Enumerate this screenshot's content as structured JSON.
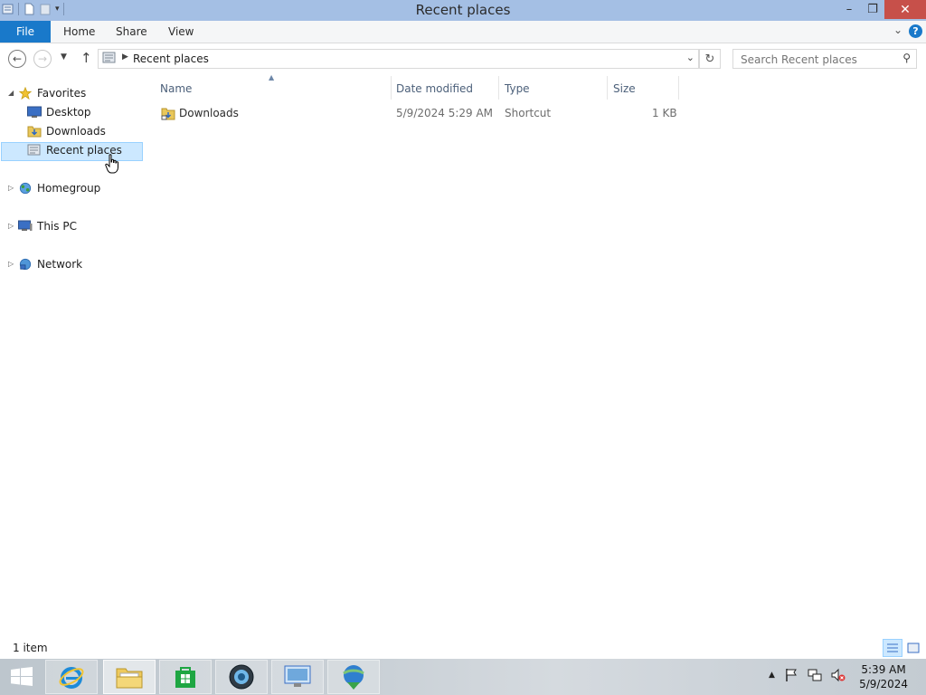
{
  "window": {
    "title": "Recent places",
    "controls": {
      "minimize": "–",
      "restore": "❐",
      "close": "✕"
    }
  },
  "ribbon": {
    "tabs": [
      {
        "label": "File"
      },
      {
        "label": "Home"
      },
      {
        "label": "Share"
      },
      {
        "label": "View"
      }
    ],
    "help": "?"
  },
  "address_bar": {
    "location": "Recent places",
    "search_placeholder": "Search Recent places"
  },
  "nav_pane": {
    "favorites": {
      "label": "Favorites",
      "items": [
        {
          "label": "Desktop",
          "icon": "desktop-icon"
        },
        {
          "label": "Downloads",
          "icon": "downloads-folder-icon"
        },
        {
          "label": "Recent places",
          "icon": "recent-places-icon",
          "selected": true
        }
      ]
    },
    "groups": [
      {
        "label": "Homegroup",
        "icon": "homegroup-icon"
      },
      {
        "label": "This PC",
        "icon": "this-pc-icon"
      },
      {
        "label": "Network",
        "icon": "network-icon"
      }
    ]
  },
  "file_list": {
    "columns": [
      "Name",
      "Date modified",
      "Type",
      "Size"
    ],
    "rows": [
      {
        "name": "Downloads",
        "date_modified": "5/9/2024 5:29 AM",
        "type": "Shortcut",
        "size": "1 KB"
      }
    ]
  },
  "status_bar": {
    "item_count": "1 item"
  },
  "taskbar": {
    "apps": [
      {
        "name": "internet-explorer"
      },
      {
        "name": "file-explorer",
        "active": true
      },
      {
        "name": "store"
      },
      {
        "name": "app-globe"
      },
      {
        "name": "remote-desktop"
      },
      {
        "name": "download-manager"
      }
    ],
    "clock": {
      "time": "5:39 AM",
      "date": "5/9/2024"
    }
  },
  "colors": {
    "titlebar": "#a4bfe4",
    "file_tab": "#1979ca",
    "close_button": "#c7504a",
    "selection": "#cce8ff"
  }
}
